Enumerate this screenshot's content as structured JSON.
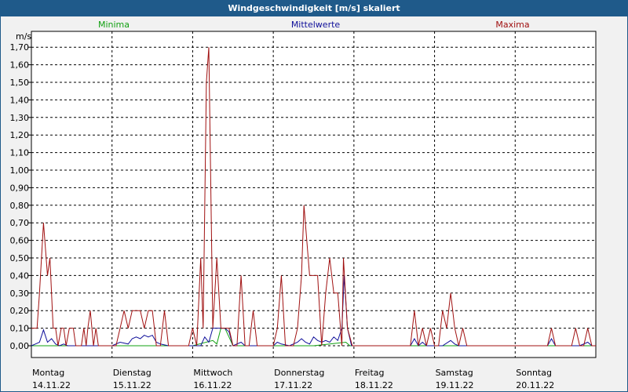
{
  "window": {
    "title": "Windgeschwindigkeit [m/s] skaliert"
  },
  "chart_data": {
    "type": "line",
    "title": "Windgeschwindigkeit [m/s] skaliert",
    "ylabel": "m/s",
    "ylim": [
      0,
      1.8
    ],
    "y_ticks": [
      "0,00",
      "0,10",
      "0,20",
      "0,30",
      "0,40",
      "0,50",
      "0,60",
      "0,70",
      "0,80",
      "0,90",
      "1,00",
      "1,10",
      "1,20",
      "1,30",
      "1,40",
      "1,50",
      "1,60",
      "1,70"
    ],
    "grid": true,
    "legend_placement": "top",
    "x_range": [
      0,
      7
    ],
    "days": [
      {
        "weekday": "Montag",
        "date": "14.11.22"
      },
      {
        "weekday": "Dienstag",
        "date": "15.11.22"
      },
      {
        "weekday": "Mittwoch",
        "date": "16.11.22"
      },
      {
        "weekday": "Donnerstag",
        "date": "17.11.22"
      },
      {
        "weekday": "Freitag",
        "date": "18.11.22"
      },
      {
        "weekday": "Samstag",
        "date": "19.11.22"
      },
      {
        "weekday": "Sonntag",
        "date": "20.11.22"
      }
    ],
    "series": [
      {
        "name": "Maxima",
        "color": "#a01010",
        "points": [
          [
            0,
            0.1
          ],
          [
            0.07,
            0.1
          ],
          [
            0.1,
            0.3
          ],
          [
            0.15,
            0.7
          ],
          [
            0.2,
            0.4
          ],
          [
            0.23,
            0.5
          ],
          [
            0.27,
            0.1
          ],
          [
            0.3,
            0.1
          ],
          [
            0.33,
            0
          ],
          [
            0.37,
            0.1
          ],
          [
            0.4,
            0.1
          ],
          [
            0.43,
            0
          ],
          [
            0.47,
            0.1
          ],
          [
            0.52,
            0.1
          ],
          [
            0.55,
            0
          ],
          [
            0.6,
            0
          ],
          [
            0.62,
            0
          ],
          [
            0.65,
            0.1
          ],
          [
            0.68,
            0
          ],
          [
            0.7,
            0.1
          ],
          [
            0.73,
            0.2
          ],
          [
            0.77,
            0
          ],
          [
            0.8,
            0.1
          ],
          [
            0.83,
            0
          ],
          [
            0.9,
            0
          ],
          [
            0.95,
            0
          ],
          [
            1.0,
            0
          ],
          [
            1.05,
            0
          ],
          [
            1.1,
            0.1
          ],
          [
            1.15,
            0.2
          ],
          [
            1.2,
            0.1
          ],
          [
            1.25,
            0.2
          ],
          [
            1.3,
            0.2
          ],
          [
            1.35,
            0.2
          ],
          [
            1.4,
            0.1
          ],
          [
            1.45,
            0.2
          ],
          [
            1.5,
            0.2
          ],
          [
            1.55,
            0
          ],
          [
            1.6,
            0
          ],
          [
            1.65,
            0.2
          ],
          [
            1.7,
            0
          ],
          [
            1.75,
            0
          ],
          [
            1.85,
            0
          ],
          [
            1.95,
            0
          ],
          [
            2.0,
            0.1
          ],
          [
            2.05,
            0
          ],
          [
            2.1,
            0.5
          ],
          [
            2.13,
            0.1
          ],
          [
            2.17,
            1.5
          ],
          [
            2.2,
            1.7
          ],
          [
            2.25,
            0.1
          ],
          [
            2.3,
            0.5
          ],
          [
            2.35,
            0.1
          ],
          [
            2.4,
            0.1
          ],
          [
            2.45,
            0.1
          ],
          [
            2.5,
            0
          ],
          [
            2.55,
            0
          ],
          [
            2.6,
            0.4
          ],
          [
            2.65,
            0
          ],
          [
            2.7,
            0
          ],
          [
            2.75,
            0.2
          ],
          [
            2.8,
            0
          ],
          [
            2.85,
            0
          ],
          [
            2.95,
            0
          ],
          [
            3.0,
            0
          ],
          [
            3.05,
            0.1
          ],
          [
            3.1,
            0.4
          ],
          [
            3.15,
            0
          ],
          [
            3.2,
            0
          ],
          [
            3.25,
            0
          ],
          [
            3.3,
            0.1
          ],
          [
            3.35,
            0.4
          ],
          [
            3.38,
            0.8
          ],
          [
            3.45,
            0.4
          ],
          [
            3.5,
            0.4
          ],
          [
            3.55,
            0.4
          ],
          [
            3.6,
            0
          ],
          [
            3.65,
            0.3
          ],
          [
            3.7,
            0.5
          ],
          [
            3.75,
            0.3
          ],
          [
            3.8,
            0.3
          ],
          [
            3.85,
            0
          ],
          [
            3.87,
            0.5
          ],
          [
            3.92,
            0.1
          ],
          [
            3.98,
            0
          ],
          [
            4.05,
            0
          ],
          [
            4.2,
            0
          ],
          [
            4.4,
            0
          ],
          [
            4.6,
            0
          ],
          [
            4.7,
            0
          ],
          [
            4.75,
            0.2
          ],
          [
            4.8,
            0
          ],
          [
            4.85,
            0.1
          ],
          [
            4.9,
            0
          ],
          [
            4.95,
            0.1
          ],
          [
            5.0,
            0
          ],
          [
            5.05,
            0
          ],
          [
            5.1,
            0.2
          ],
          [
            5.15,
            0.1
          ],
          [
            5.2,
            0.3
          ],
          [
            5.25,
            0.1
          ],
          [
            5.3,
            0
          ],
          [
            5.35,
            0.1
          ],
          [
            5.4,
            0
          ],
          [
            5.5,
            0
          ],
          [
            5.7,
            0
          ],
          [
            5.9,
            0
          ],
          [
            6.1,
            0
          ],
          [
            6.3,
            0
          ],
          [
            6.4,
            0
          ],
          [
            6.45,
            0.1
          ],
          [
            6.5,
            0
          ],
          [
            6.6,
            0
          ],
          [
            6.7,
            0
          ],
          [
            6.75,
            0.1
          ],
          [
            6.8,
            0
          ],
          [
            6.85,
            0
          ],
          [
            6.9,
            0.1
          ],
          [
            6.95,
            0
          ],
          [
            7.0,
            0
          ]
        ]
      },
      {
        "name": "Mittelwerte",
        "color": "#10109a",
        "points": [
          [
            0,
            0
          ],
          [
            0.05,
            0.01
          ],
          [
            0.1,
            0.02
          ],
          [
            0.15,
            0.09
          ],
          [
            0.2,
            0.02
          ],
          [
            0.25,
            0.04
          ],
          [
            0.3,
            0.01
          ],
          [
            0.35,
            0
          ],
          [
            0.4,
            0.01
          ],
          [
            0.45,
            0
          ],
          [
            0.5,
            0
          ],
          [
            0.6,
            0
          ],
          [
            0.7,
            0
          ],
          [
            0.8,
            0
          ],
          [
            0.9,
            0
          ],
          [
            1.0,
            0
          ],
          [
            1.1,
            0.02
          ],
          [
            1.2,
            0.01
          ],
          [
            1.25,
            0.04
          ],
          [
            1.3,
            0.05
          ],
          [
            1.35,
            0.04
          ],
          [
            1.4,
            0.06
          ],
          [
            1.45,
            0.05
          ],
          [
            1.5,
            0.06
          ],
          [
            1.55,
            0.02
          ],
          [
            1.6,
            0.01
          ],
          [
            1.7,
            0
          ],
          [
            1.9,
            0
          ],
          [
            2.1,
            0
          ],
          [
            2.15,
            0.05
          ],
          [
            2.2,
            0.02
          ],
          [
            2.25,
            0.1
          ],
          [
            2.3,
            0.1
          ],
          [
            2.35,
            0.1
          ],
          [
            2.4,
            0.1
          ],
          [
            2.45,
            0.08
          ],
          [
            2.5,
            0
          ],
          [
            2.6,
            0.02
          ],
          [
            2.65,
            0
          ],
          [
            2.8,
            0
          ],
          [
            3.0,
            0
          ],
          [
            3.05,
            0.02
          ],
          [
            3.1,
            0.01
          ],
          [
            3.2,
            0
          ],
          [
            3.3,
            0.02
          ],
          [
            3.35,
            0.04
          ],
          [
            3.4,
            0.02
          ],
          [
            3.45,
            0.01
          ],
          [
            3.5,
            0.05
          ],
          [
            3.55,
            0.03
          ],
          [
            3.6,
            0.02
          ],
          [
            3.65,
            0.03
          ],
          [
            3.7,
            0.02
          ],
          [
            3.75,
            0.05
          ],
          [
            3.8,
            0.03
          ],
          [
            3.85,
            0.1
          ],
          [
            3.88,
            0.4
          ],
          [
            3.92,
            0.1
          ],
          [
            3.97,
            0
          ],
          [
            4.1,
            0
          ],
          [
            4.4,
            0
          ],
          [
            4.7,
            0
          ],
          [
            4.75,
            0.04
          ],
          [
            4.8,
            0
          ],
          [
            4.85,
            0.02
          ],
          [
            4.9,
            0
          ],
          [
            5.0,
            0
          ],
          [
            5.1,
            0
          ],
          [
            5.2,
            0.03
          ],
          [
            5.25,
            0.01
          ],
          [
            5.3,
            0
          ],
          [
            5.5,
            0
          ],
          [
            5.8,
            0
          ],
          [
            6.1,
            0
          ],
          [
            6.4,
            0
          ],
          [
            6.45,
            0.04
          ],
          [
            6.5,
            0
          ],
          [
            6.6,
            0
          ],
          [
            6.8,
            0
          ],
          [
            6.9,
            0.02
          ],
          [
            6.95,
            0
          ],
          [
            7.0,
            0
          ]
        ]
      },
      {
        "name": "Minima",
        "color": "#12a012",
        "points": [
          [
            0,
            0
          ],
          [
            0.5,
            0
          ],
          [
            1.0,
            0
          ],
          [
            1.5,
            0
          ],
          [
            2.0,
            0
          ],
          [
            2.25,
            0.03
          ],
          [
            2.3,
            0.01
          ],
          [
            2.35,
            0.1
          ],
          [
            2.4,
            0.1
          ],
          [
            2.45,
            0.05
          ],
          [
            2.5,
            0
          ],
          [
            3.0,
            0
          ],
          [
            3.5,
            0
          ],
          [
            3.9,
            0.02
          ],
          [
            3.95,
            0
          ],
          [
            4.5,
            0
          ],
          [
            5.0,
            0
          ],
          [
            6.0,
            0
          ],
          [
            7.0,
            0
          ]
        ]
      }
    ]
  }
}
